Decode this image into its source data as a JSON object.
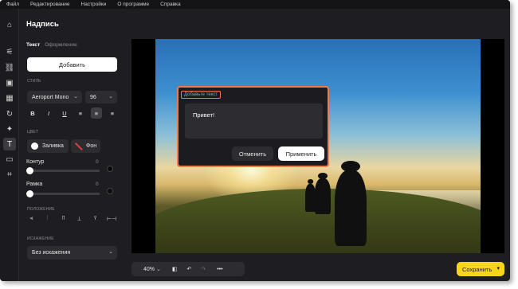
{
  "menu": [
    "Файл",
    "Редактирование",
    "Настройки",
    "О программе",
    "Справка"
  ],
  "toolbar": {
    "icons": [
      "home-icon",
      "sliders-icon",
      "link-icon",
      "subtitle-icon",
      "photo-icon",
      "rotate-icon",
      "sparkle-icon",
      "text-icon",
      "crop-frame-icon",
      "crop-icon"
    ],
    "glyphs": [
      "⌂",
      "⚟",
      "⛓",
      "▣",
      "▦",
      "↻",
      "✦",
      "T",
      "▭",
      "⌗"
    ],
    "active_index": 7
  },
  "panel": {
    "title": "Надпись",
    "tabs": [
      "Текст",
      "Оформление"
    ],
    "add_button": "Добавить",
    "style_label": "СТИЛЬ",
    "font": "Aeroport Mono",
    "size": "96",
    "format_buttons": [
      "B",
      "I",
      "U",
      "≡",
      "≡",
      "≡"
    ],
    "color_label": "ЦВЕТ",
    "fill_label": "Заливка",
    "bg_label": "Фон",
    "outline_label": "Контур",
    "outline_value": "0",
    "frame_label": "Рамка",
    "frame_value": "0",
    "position_label": "ПОЛОЖЕНИЕ",
    "position_icons": [
      "⫷",
      "⫶",
      "⫪",
      "⊥",
      "⫯",
      "⊢⊣"
    ],
    "distortion_label": "ИСКАЖЕНИЕ",
    "distortion_value": "Без искажения"
  },
  "dialog": {
    "title": "Добавьте текст",
    "text": "Привет!",
    "cancel": "Отменить",
    "apply": "Применить"
  },
  "bottom": {
    "zoom": "40%",
    "save": "Сохранить"
  },
  "colors": {
    "accent": "#f07a4a",
    "save": "#f7d61a",
    "panel": "#1e1e22"
  }
}
